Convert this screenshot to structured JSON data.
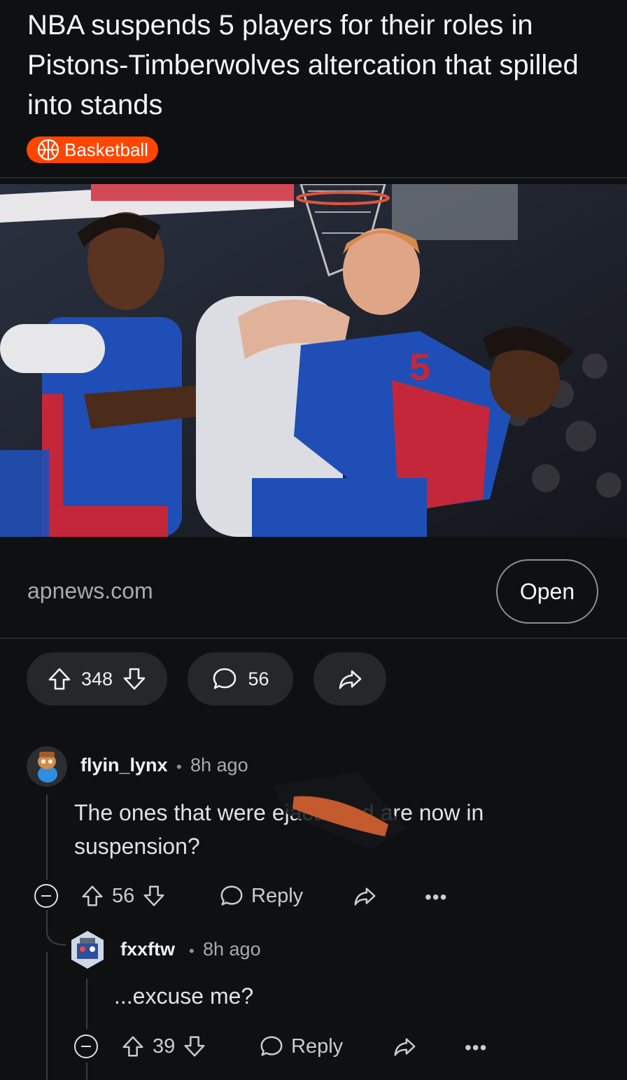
{
  "post": {
    "title": "NBA suspends 5 players for their roles in Pistons-Timberwolves altercation that spilled into stands",
    "flair": "Basketball",
    "flair_icon": "basketball-icon",
    "link_domain": "apnews.com",
    "open_label": "Open",
    "score": "348",
    "comments_count": "56"
  },
  "comments": [
    {
      "username": "flyin_lynx",
      "time": "8h ago",
      "body": "The ones that were ejaculated are now in suspension?",
      "score": "56",
      "reply_label": "Reply",
      "more": "•••"
    },
    {
      "username": "fxxftw",
      "time": "8h ago",
      "body": "...excuse me?",
      "score": "39",
      "reply_label": "Reply",
      "more": "•••"
    }
  ],
  "separator": "•",
  "colors": {
    "background": "#0f1012",
    "flair": "#ff4500",
    "pill": "#25272b"
  }
}
